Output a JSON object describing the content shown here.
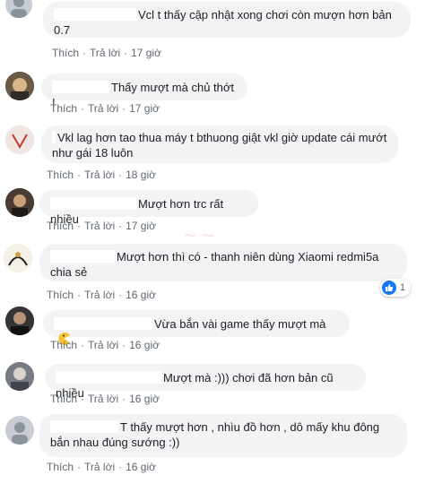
{
  "actions": {
    "like": "Thích",
    "reply": "Trả lời",
    "sep": "·"
  },
  "comments": [
    {
      "text": "Vcl t thấy cập nhật xong chơi còn mượn hơn bản 0.7",
      "time": "17 giờ"
    },
    {
      "text": "Thấy mượt mà chủ thớt !",
      "time": "17 giờ"
    },
    {
      "text": "Vkl lag hơn tao thua máy t bthuong giật vkl giờ update cái mướt như gái 18 luôn",
      "time": "18 giờ"
    },
    {
      "text": "Mượt hơn trc rất nhiều",
      "time": "17 giờ"
    },
    {
      "text": "Mượt hơn thì có - thanh niên dùng Xiaomi redmi5a chia sẻ",
      "time": "16 giờ",
      "reaction_count": "1"
    },
    {
      "text": "Vừa bắn vài game thấy mượt mà",
      "time": "16 giờ"
    },
    {
      "text": "Mượt mà :))) chơi đã hơn bản cũ nhiều",
      "time": "16 giờ"
    },
    {
      "text": "T thấy mượt hơn , nhìu đồ hơn , dô mấy khu đông bắn nhau đúng sướng :))",
      "time": "16 giờ"
    }
  ],
  "colors": {
    "bubble": "#f2f3f5",
    "action_text": "#606770",
    "like_blue": "#1877f2"
  }
}
